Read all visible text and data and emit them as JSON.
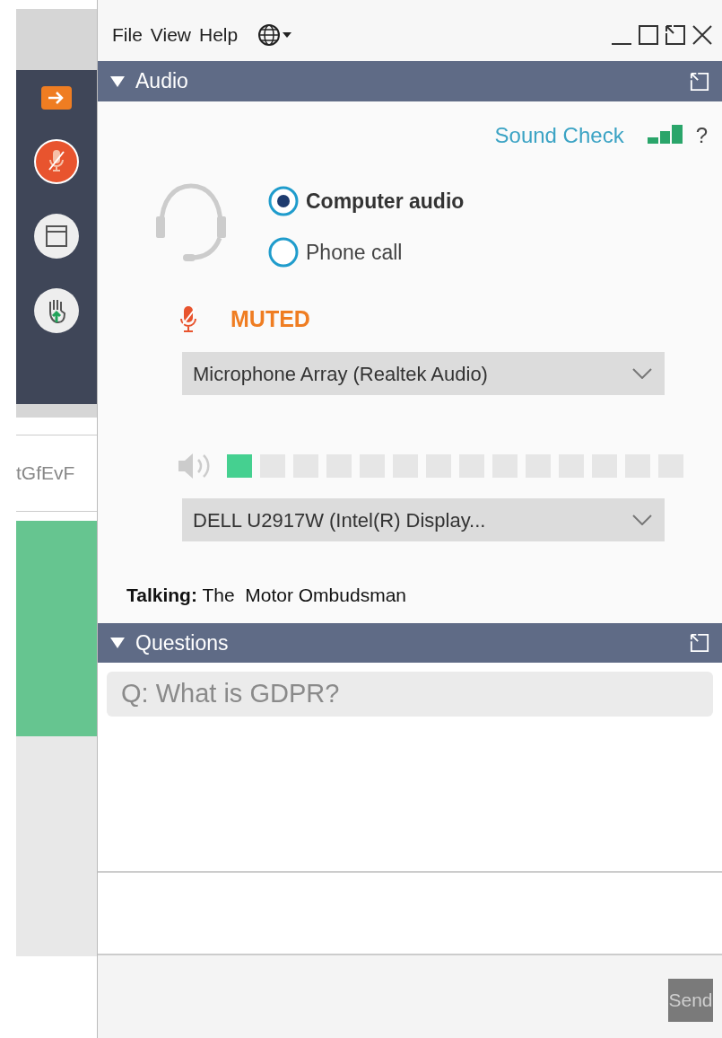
{
  "background_page": {
    "fragment_text": "tGfEvF"
  },
  "menu_bar": {
    "items": [
      "File",
      "View",
      "Help"
    ]
  },
  "audio": {
    "title": "Audio",
    "expanded": true,
    "sound_check": "Sound Check",
    "help": "?",
    "options": [
      {
        "label": "Computer audio",
        "selected": true
      },
      {
        "label": "Phone call",
        "selected": false
      }
    ],
    "mic_status": {
      "muted": true,
      "label": "MUTED"
    },
    "microphone": "Microphone Array (Realtek Audio)",
    "speaker_meter": {
      "level": 0.07
    },
    "speaker": "DELL U2917W (Intel(R) Display...",
    "talking": "**Talking:** The  Motor Ombudsman"
  },
  "questions": {
    "title": "Questions",
    "expanded": true,
    "items": [
      "Q: What is GDPR?"
    ],
    "send": {
      "label": "Send",
      "disabled": true
    }
  }
}
